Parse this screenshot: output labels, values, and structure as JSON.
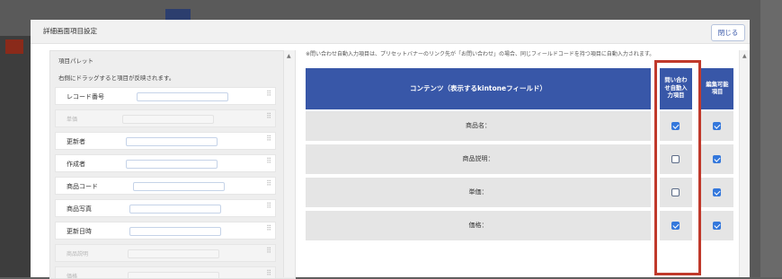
{
  "dialog": {
    "title": "詳細画面項目設定",
    "close_label": "閉じる"
  },
  "palette": {
    "title": "項目パレット",
    "hint": "右側にドラッグすると項目が反映されます。",
    "items": [
      {
        "label": "レコード番号",
        "disabled": false
      },
      {
        "label": "単価",
        "disabled": true
      },
      {
        "label": "更新者",
        "disabled": false
      },
      {
        "label": "作成者",
        "disabled": false
      },
      {
        "label": "商品コード",
        "disabled": false
      },
      {
        "label": "商品写真",
        "disabled": false
      },
      {
        "label": "更新日時",
        "disabled": false
      },
      {
        "label": "商品説明",
        "disabled": true
      },
      {
        "label": "価格",
        "disabled": true
      }
    ],
    "drag_icon": "⠿"
  },
  "main": {
    "note": "※問い合わせ自動入力項目は、プリセットバナーのリンク先が「お問い合わせ」の場合、同じフィールドコードを持つ項目に自動入力されます。",
    "header_content": "コンテンツ（表示するkintoneフィールド）",
    "header_auto_input": "問い合わせ自動入力項目",
    "header_auto_input_lines": [
      "問い合わ",
      "せ自動入",
      "力項目"
    ],
    "header_editable_lines": [
      "編集可能",
      "項目"
    ],
    "rows": [
      {
        "label": "商品名：",
        "auto_input": true,
        "editable": true
      },
      {
        "label": "商品説明：",
        "auto_input": false,
        "editable": true
      },
      {
        "label": "単価：",
        "auto_input": false,
        "editable": true
      },
      {
        "label": "価格：",
        "auto_input": true,
        "editable": true
      }
    ]
  },
  "colors": {
    "header_blue": "#3857a8",
    "highlight_red": "#c0392b",
    "checkbox_blue": "#3478dc"
  }
}
